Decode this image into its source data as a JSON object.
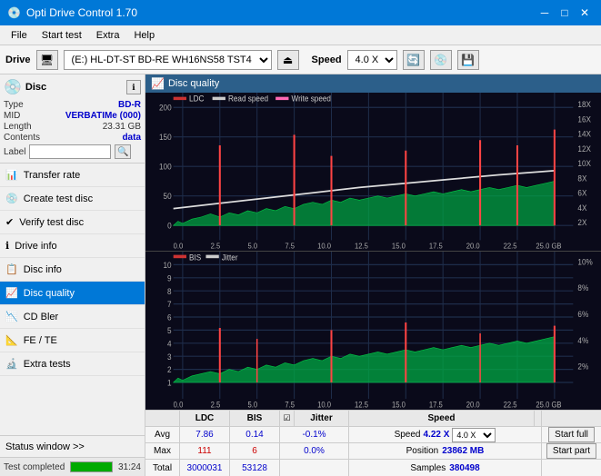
{
  "titlebar": {
    "title": "Opti Drive Control 1.70",
    "icon": "💿",
    "minimize": "─",
    "maximize": "□",
    "close": "✕"
  },
  "menu": {
    "items": [
      "File",
      "Start test",
      "Extra",
      "Help"
    ]
  },
  "drivebar": {
    "label": "Drive",
    "drive_value": "(E:) HL-DT-ST BD-RE  WH16NS58 TST4",
    "speed_label": "Speed",
    "speed_value": "4.0 X"
  },
  "disc": {
    "header": "Disc",
    "type_label": "Type",
    "type_value": "BD-R",
    "mid_label": "MID",
    "mid_value": "VERBATIMe (000)",
    "length_label": "Length",
    "length_value": "23.31 GB",
    "contents_label": "Contents",
    "contents_value": "data",
    "label_label": "Label"
  },
  "nav": {
    "items": [
      {
        "id": "transfer-rate",
        "label": "Transfer rate",
        "icon": "📊"
      },
      {
        "id": "create-test-disc",
        "label": "Create test disc",
        "icon": "💿"
      },
      {
        "id": "verify-test-disc",
        "label": "Verify test disc",
        "icon": "✔"
      },
      {
        "id": "drive-info",
        "label": "Drive info",
        "icon": "ℹ"
      },
      {
        "id": "disc-info",
        "label": "Disc info",
        "icon": "📋"
      },
      {
        "id": "disc-quality",
        "label": "Disc quality",
        "icon": "📈",
        "active": true
      },
      {
        "id": "cd-bler",
        "label": "CD Bler",
        "icon": "📉"
      },
      {
        "id": "fe-te",
        "label": "FE / TE",
        "icon": "📐"
      },
      {
        "id": "extra-tests",
        "label": "Extra tests",
        "icon": "🔬"
      }
    ]
  },
  "chart_header": {
    "title": "Disc quality",
    "icon": "📈"
  },
  "chart_top": {
    "legend": [
      {
        "label": "LDC",
        "color": "#cc0000"
      },
      {
        "label": "Read speed",
        "color": "#cccccc"
      },
      {
        "label": "Write speed",
        "color": "#ff69b4"
      }
    ],
    "y_axis": [
      "200",
      "150",
      "100",
      "50",
      "0"
    ],
    "y_axis_right": [
      "18X",
      "16X",
      "14X",
      "12X",
      "10X",
      "8X",
      "6X",
      "4X",
      "2X"
    ],
    "x_axis": [
      "0.0",
      "2.5",
      "5.0",
      "7.5",
      "10.0",
      "12.5",
      "15.0",
      "17.5",
      "20.0",
      "22.5",
      "25.0 GB"
    ]
  },
  "chart_bottom": {
    "legend": [
      {
        "label": "BIS",
        "color": "#cc0000"
      },
      {
        "label": "Jitter",
        "color": "#cccccc"
      }
    ],
    "y_axis": [
      "10",
      "9",
      "8",
      "7",
      "6",
      "5",
      "4",
      "3",
      "2",
      "1"
    ],
    "y_axis_right": [
      "10%",
      "8%",
      "6%",
      "4%",
      "2%"
    ],
    "x_axis": [
      "0.0",
      "2.5",
      "5.0",
      "7.5",
      "10.0",
      "12.5",
      "15.0",
      "17.5",
      "20.0",
      "22.5",
      "25.0 GB"
    ]
  },
  "stats": {
    "headers": [
      "",
      "LDC",
      "BIS",
      "",
      "Jitter",
      "Speed",
      ""
    ],
    "avg_label": "Avg",
    "avg_ldc": "7.86",
    "avg_bis": "0.14",
    "avg_jitter": "-0.1%",
    "max_label": "Max",
    "max_ldc": "111",
    "max_bis": "6",
    "max_jitter": "0.0%",
    "total_label": "Total",
    "total_ldc": "3000031",
    "total_bis": "53128",
    "speed_label": "Speed",
    "speed_value": "4.22 X",
    "speed_select": "4.0 X",
    "position_label": "Position",
    "position_value": "23862 MB",
    "samples_label": "Samples",
    "samples_value": "380498",
    "jitter_checked": true,
    "start_full_label": "Start full",
    "start_part_label": "Start part"
  },
  "statusbar": {
    "status_window_label": "Status window >>",
    "status_text": "Test completed",
    "progress_value": 100,
    "time_value": "31:24"
  }
}
